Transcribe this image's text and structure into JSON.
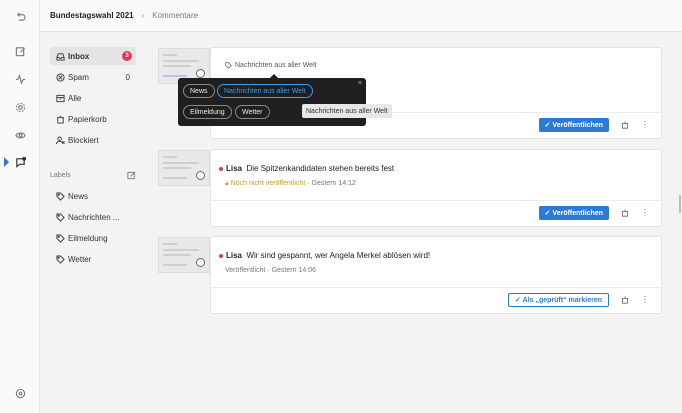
{
  "breadcrumb": {
    "project": "Bundestagswahl 2021",
    "separator": "›",
    "section": "Kommentare"
  },
  "sidebar": {
    "inbox": {
      "label": "Inbox",
      "badge": "3"
    },
    "spam": {
      "label": "Spam",
      "count": "0"
    },
    "all": {
      "label": "Alle"
    },
    "trash": {
      "label": "Papierkorb"
    },
    "blocked": {
      "label": "Blockiert"
    },
    "labels_title": "Labels",
    "labels": [
      "News",
      "Nachrichten ...",
      "Eilmeldung",
      "Wetter"
    ]
  },
  "label_popup": {
    "options": [
      "News",
      "Nachrichten aus aller Welt",
      "Eilmeldung",
      "Wetter"
    ],
    "selected": "Nachrichten aus aller Welt",
    "close": "×",
    "tooltip": "Nachrichten aus aller Welt"
  },
  "comments": [
    {
      "tag": "Nachrichten aus aller Welt",
      "action": "Veröffentlichen"
    },
    {
      "author": "Lisa",
      "text": "Die Spitzenkandidaten stehen bereits fest",
      "status": "Noch nicht veröffentlicht",
      "time": "Gestern 14:12",
      "action": "Veröffentlichen"
    },
    {
      "author": "Lisa",
      "text": "Wir sind gespannt, wer Angela Merkel ablösen wird!",
      "status": "Veröffentlicht",
      "time": "Gestern 14:06",
      "action": "Als „geprüft“ markieren"
    }
  ],
  "meta_separator": "·",
  "more_glyph": "⋮",
  "colors": {
    "accent": "#2a7bd6",
    "badge": "#e0385b",
    "warning": "#d29a1e",
    "popup_bg": "#1f1f1f"
  }
}
